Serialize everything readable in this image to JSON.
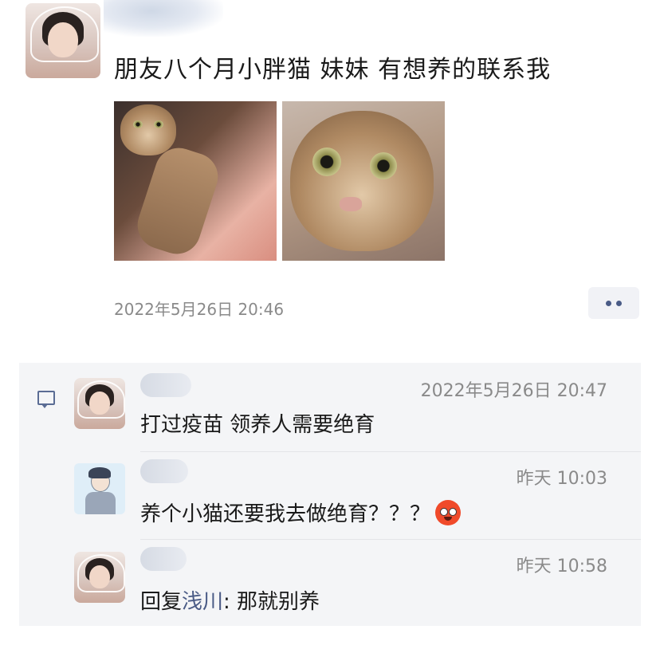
{
  "post": {
    "text": "朋友八个月小胖猫 妹妹 有想养的联系我",
    "time": "2022年5月26日 20:46"
  },
  "comments": [
    {
      "time": "2022年5月26日 20:47",
      "text": "打过疫苗 领养人需要绝育"
    },
    {
      "time": "昨天 10:03",
      "text": "养个小猫还要我去做绝育？？？"
    },
    {
      "time": "昨天 10:58",
      "reply_prefix": "回复",
      "reply_to": "浅川",
      "text": ": 那就别养"
    }
  ],
  "icons": {
    "more": "more-dots-icon",
    "comment": "comment-icon",
    "emoji": "flushed-face-emoji"
  },
  "colors": {
    "link": "#4a5b86",
    "comment_bg": "#f4f5f7",
    "timestamp": "#8a8a8a"
  }
}
